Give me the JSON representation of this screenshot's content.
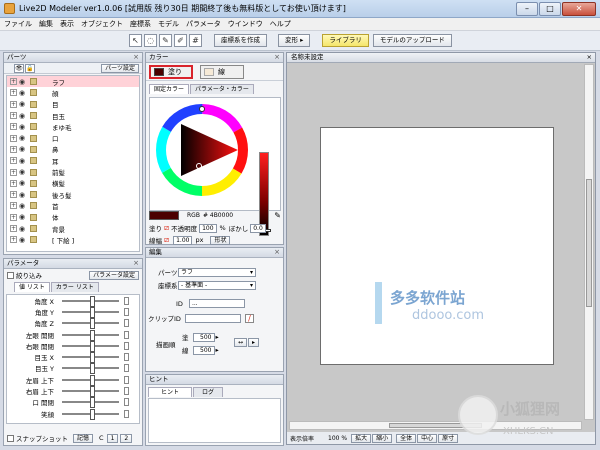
{
  "window": {
    "title": "Live2D Modeler ver1.0.06 [試用版 残り30日 期間終了後も無料版としてお使い頂けます]",
    "controls": [
      "–",
      "□",
      "✕"
    ]
  },
  "menu": [
    "ファイル",
    "編集",
    "表示",
    "オブジェクト",
    "座標系",
    "モデル",
    "パラメータ",
    "ウインドウ",
    "ヘルプ"
  ],
  "toolbar": {
    "tool_icons": [
      {
        "icon": "arrow-cursor-icon",
        "glyph": "↖"
      },
      {
        "icon": "lasso-icon",
        "glyph": "◌"
      },
      {
        "icon": "pen-icon",
        "glyph": "✎"
      },
      {
        "icon": "brush-icon",
        "glyph": "✐"
      },
      {
        "icon": "grid-icon",
        "glyph": "#"
      }
    ],
    "create_coord_label": "座標系を作成",
    "transform_label": "変形 ▸",
    "library_label": "ライブラリ",
    "upload_label": "モデルのアップロード"
  },
  "parts_panel": {
    "title": "パーツ",
    "settings_label": "パーツ設定",
    "items": [
      "ラフ",
      "顔",
      "目",
      "目玉",
      "まゆ毛",
      "口",
      "鼻",
      "耳",
      "前髪",
      "横髪",
      "後ろ髪",
      "首",
      "体",
      "背景",
      "[ 下絵 ]"
    ],
    "selected_index": 0
  },
  "params_panel": {
    "title": "パラメータ",
    "filter_label": "絞り込み",
    "settings_label": "パラメータ設定",
    "tab_values": "値 リスト",
    "tab_colors": "カラー リスト",
    "items": [
      "角度 X",
      "角度 Y",
      "角度 Z",
      "左眼 開閉",
      "右眼 開閉",
      "目玉 X",
      "目玉 Y",
      "左眉 上下",
      "右眉 上下",
      "口 開閉",
      "笑顔"
    ],
    "snapshot_label": "スナップショット",
    "record_label": "記憶",
    "c_label": "C",
    "page1": "1",
    "page2": "2"
  },
  "color_panel": {
    "title": "カラー",
    "fill_label": "塗り",
    "line_label": "線",
    "tab_fixed": "固定カラー",
    "tab_param": "パラメータ・カラー",
    "rgb_label": "RGB",
    "rgb_value": "# 4B0000",
    "fill_row_label": "塗り",
    "opacity_label": "不透明度",
    "opacity_value": "100",
    "percent": "%",
    "blur_label": "ぼかし",
    "blur_value": "0.0",
    "line_width_label": "線幅",
    "line_width_value": "1.00",
    "px": "px",
    "shape_label": "形状",
    "current_color": "#4b0000"
  },
  "edit_panel": {
    "title": "編集",
    "parts_label": "パーツ",
    "parts_value": "ラフ",
    "coord_label": "座標系",
    "coord_value": "- 基準面 -",
    "id_label": "ID",
    "id_value": "...",
    "clip_id_label": "クリップID",
    "draw_order_label": "描画順",
    "fill_label": "塗",
    "fill_value": "500",
    "line_label": "線",
    "line_value": "500"
  },
  "hint_panel": {
    "title": "ヒント",
    "tab_hint": "ヒント",
    "tab_log": "ログ"
  },
  "canvas": {
    "doc_title": "名称未設定",
    "status_zoom_label": "表示倍率",
    "status_zoom_value": "100 %",
    "zoom_in": "拡大",
    "zoom_out": "縮小",
    "fit_all": "全体",
    "center": "中心",
    "actual": "原寸"
  },
  "watermarks": {
    "site_cn": "多多软件站",
    "site_url": "ddooo.com",
    "fox_cn": "小狐狸网",
    "fox_url": "XHLKS.CN"
  }
}
